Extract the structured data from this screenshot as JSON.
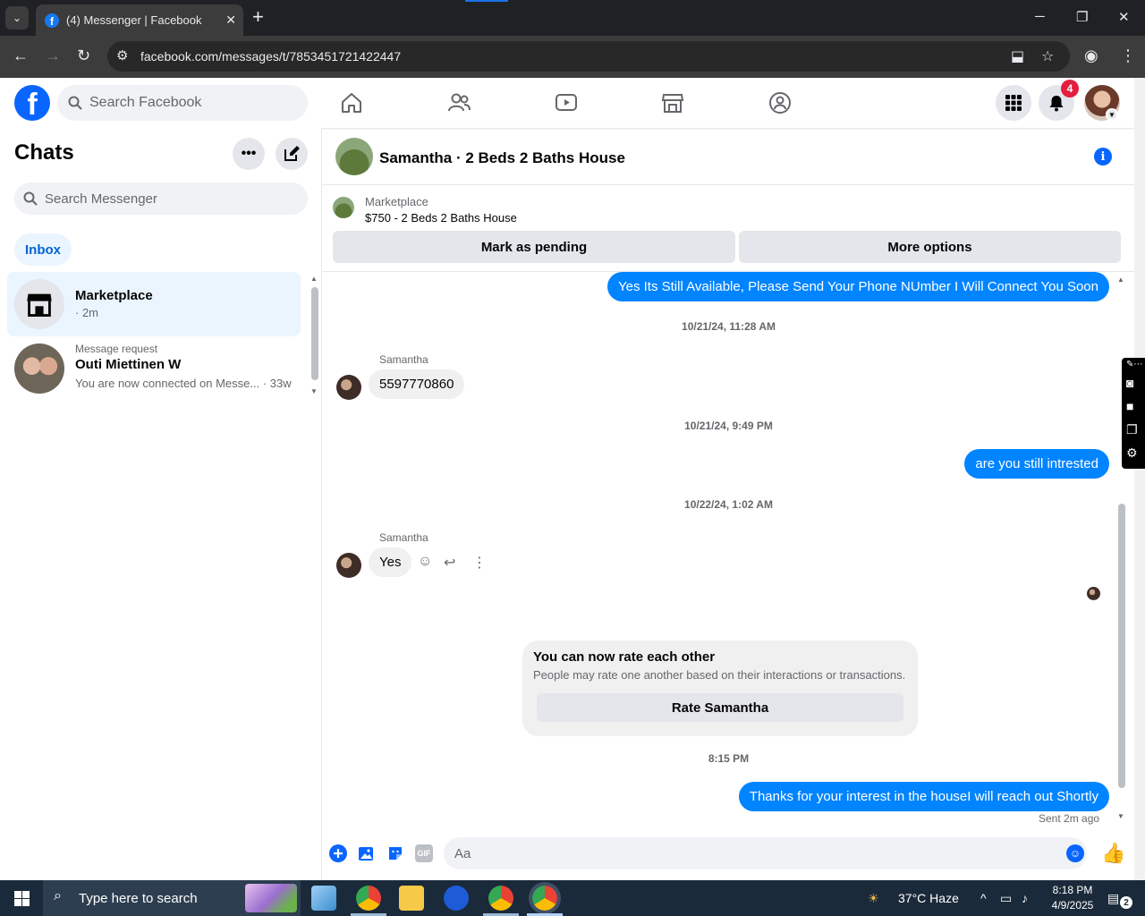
{
  "browser": {
    "tab_title": "(4) Messenger | Facebook",
    "new_tab": "+",
    "url": "facebook.com/messages/t/7853451721422447",
    "window_controls": {
      "minimize": "─",
      "restore": "❐",
      "close": "✕"
    }
  },
  "fb_header": {
    "logo_letter": "f",
    "search_placeholder": "Search Facebook",
    "notification_count": "4"
  },
  "left_panel": {
    "title": "Chats",
    "more_label": "•••",
    "search_placeholder": "Search Messenger",
    "inbox_label": "Inbox",
    "chats": [
      {
        "name": "Marketplace",
        "subtitle": "· 2m",
        "request_label": ""
      },
      {
        "name": "Outi Miettinen W",
        "subtitle": "You are now connected on Messe... · 33w",
        "request_label": "Message request"
      }
    ]
  },
  "conversation": {
    "title": "Samantha · 2 Beds 2 Baths House",
    "marketplace_label": "Marketplace",
    "listing": "$750 - 2 Beds 2 Baths House",
    "mark_pending": "Mark as pending",
    "more_options": "More options",
    "messages": [
      {
        "type": "out",
        "text": "Yes Its Still Available, Please Send Your Phone NUmber I Will Connect You Soon"
      },
      {
        "type": "ts",
        "text": "10/21/24, 11:28 AM"
      },
      {
        "type": "sender",
        "text": "Samantha"
      },
      {
        "type": "in",
        "text": "5597770860"
      },
      {
        "type": "ts",
        "text": "10/21/24, 9:49 PM"
      },
      {
        "type": "out",
        "text": "are you still intrested"
      },
      {
        "type": "ts",
        "text": "10/22/24, 1:02 AM"
      },
      {
        "type": "sender",
        "text": "Samantha"
      },
      {
        "type": "in",
        "text": "Yes"
      },
      {
        "type": "ts",
        "text": "8:15 PM"
      },
      {
        "type": "out",
        "text": "Thanks for your interest in the houseI will reach out Shortly"
      }
    ],
    "rate_card": {
      "title": "You can now rate each other",
      "description": "People may rate one another based on their interactions or transactions.",
      "button": "Rate Samantha"
    },
    "sent_note": "Sent 2m ago",
    "composer_placeholder": "Aa",
    "gif_label": "GIF"
  },
  "taskbar": {
    "search_placeholder": "Type here to search",
    "weather": "37°C  Haze",
    "time": "8:18 PM",
    "date": "4/9/2025",
    "notif_count": "2"
  },
  "colors": {
    "fb_blue": "#0866ff",
    "messenger_blue": "#0084ff",
    "notification_red": "#e41e3f",
    "chrome_dark": "#202124"
  }
}
